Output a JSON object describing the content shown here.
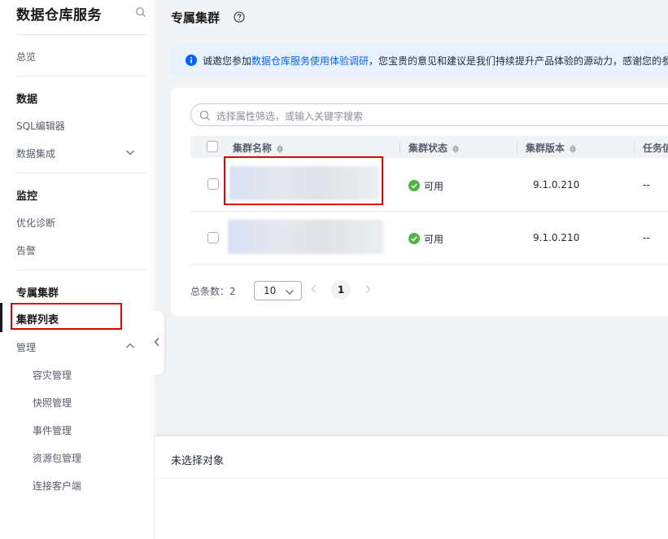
{
  "sidebar": {
    "title": "数据仓库服务",
    "overview": "总览",
    "groups": {
      "data": "数据",
      "monitor": "监控",
      "dedicated": "专属集群"
    },
    "items": {
      "sql_editor": "SQL编辑器",
      "data_integration": "数据集成",
      "optimize": "优化诊断",
      "alarm": "告警",
      "cluster_list": "集群列表",
      "manage": "管理"
    },
    "sub_items": [
      "容灾管理",
      "快照管理",
      "事件管理",
      "资源包管理",
      "连接客户端"
    ]
  },
  "header": {
    "title": "专属集群"
  },
  "notice": {
    "prefix": "诚邀您参加",
    "link": "数据仓库服务使用体验调研",
    "suffix": "，您宝贵的意见和建议是我们持续提升产品体验的源动力，感谢您的参"
  },
  "search": {
    "placeholder": "选择属性筛选，或输入关键字搜索"
  },
  "table": {
    "columns": [
      "集群名称",
      "集群状态",
      "集群版本",
      "任务信"
    ],
    "rows": [
      {
        "status": "可用",
        "version": "9.1.0.210",
        "task": "--"
      },
      {
        "status": "可用",
        "version": "9.1.0.210",
        "task": "--"
      }
    ]
  },
  "pagination": {
    "total_label": "总条数：",
    "total": "2",
    "page_size": "10",
    "current_page": "1"
  },
  "bottom_panel": {
    "label": "未选择对象"
  },
  "colors": {
    "accent": "#0066ff",
    "success": "#50b444",
    "highlight": "#e00000",
    "notice_bg": "#e8f1ff"
  }
}
